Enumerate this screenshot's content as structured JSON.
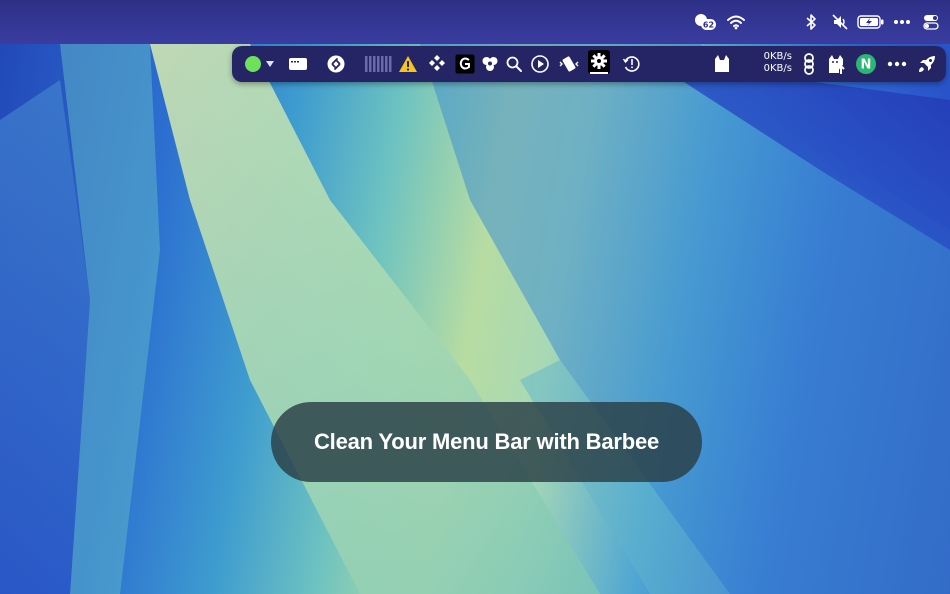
{
  "menubar": {
    "weather_badge": "62",
    "icons": [
      "weather-icon",
      "wifi-icon",
      "bluetooth-icon",
      "muted-speaker-icon",
      "battery-charging-icon",
      "more-icon",
      "control-center-icon"
    ]
  },
  "barbee": {
    "net_up": "0KB/s",
    "net_down": "0KB/s",
    "avatar_letter": "N",
    "icons": [
      "barbee-toggle-icon",
      "window-icon",
      "shazam-icon",
      "activity-meter-icon",
      "warning-icon",
      "diamond-grid-icon",
      "logitech-g-icon",
      "clover-icon",
      "search-icon",
      "play-icon",
      "shake-icon",
      "gear-icon",
      "time-machine-icon",
      "cat-icon",
      "network-speed",
      "link-icon",
      "upload-icon",
      "avatar",
      "more-icon",
      "rocket-icon"
    ]
  },
  "caption": {
    "text": "Clean Your Menu Bar with Barbee"
  },
  "colors": {
    "menubar": "#2d2f86",
    "barbee_bg": "#252566",
    "toggle_green": "#6ee05a",
    "warning_yellow": "#f5c518",
    "avatar_green": "#2bb673"
  }
}
